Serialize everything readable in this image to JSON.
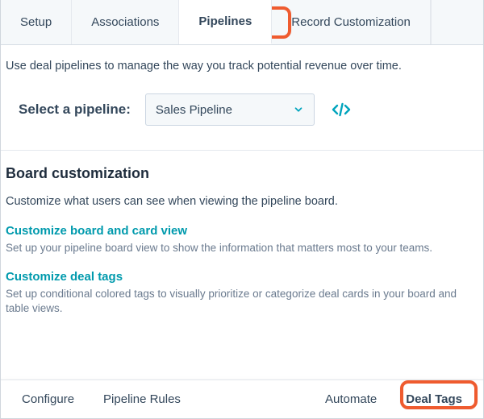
{
  "top_tabs": {
    "setup": "Setup",
    "associations": "Associations",
    "pipelines": "Pipelines",
    "record_customization": "Record Customization"
  },
  "intro": "Use deal pipelines to manage the way you track potential revenue over time.",
  "pipeline": {
    "label": "Select a pipeline:",
    "selected": "Sales Pipeline"
  },
  "board": {
    "heading": "Board customization",
    "description": "Customize what users can see when viewing the pipeline board.",
    "link1_title": "Customize board and card view",
    "link1_sub": "Set up your pipeline board view to show the information that matters most to your teams.",
    "link2_title": "Customize deal tags",
    "link2_sub": "Set up conditional colored tags to visually prioritize or categorize deal cards in your board and table views."
  },
  "bottom_tabs": {
    "configure": "Configure",
    "pipeline_rules": "Pipeline Rules",
    "automate": "Automate",
    "deal_tags": "Deal Tags"
  },
  "colors": {
    "accent_teal": "#00a4bd",
    "callout_orange": "#ef5b2f"
  }
}
